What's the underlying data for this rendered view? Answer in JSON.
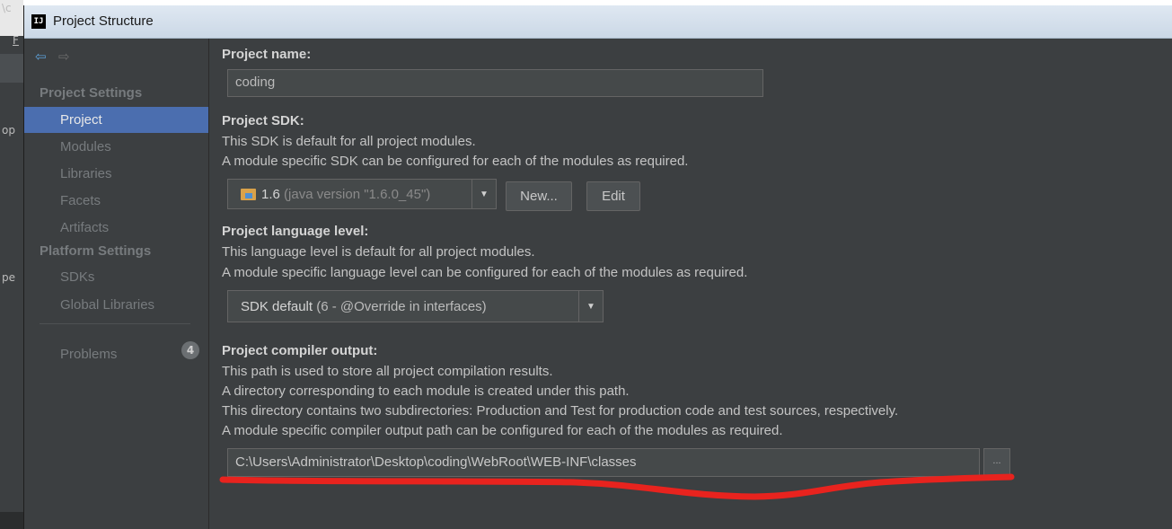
{
  "background_fragments": [
    "\\c",
    "F",
    "op",
    "pe"
  ],
  "window": {
    "title": "Project Structure",
    "logo_text": "IJ"
  },
  "sidebar": {
    "project_settings_header": "Project Settings",
    "project_settings_items": [
      {
        "label": "Project",
        "selected": true
      },
      {
        "label": "Modules"
      },
      {
        "label": "Libraries"
      },
      {
        "label": "Facets"
      },
      {
        "label": "Artifacts"
      }
    ],
    "platform_settings_header": "Platform Settings",
    "platform_settings_items": [
      {
        "label": "SDKs"
      },
      {
        "label": "Global Libraries"
      }
    ],
    "problems": {
      "label": "Problems",
      "count": "4"
    }
  },
  "main": {
    "project_name": {
      "label": "Project name:",
      "value": "coding"
    },
    "project_sdk": {
      "label": "Project SDK:",
      "desc1": "This SDK is default for all project modules.",
      "desc2": "A module specific SDK can be configured for each of the modules as required.",
      "selected_version": "1.6",
      "selected_detail": " (java version \"1.6.0_45\")",
      "new_button": "New...",
      "edit_button": "Edit"
    },
    "language_level": {
      "label": "Project language level:",
      "desc1": "This language level is default for all project modules.",
      "desc2": "A module specific language level can be configured for each of the modules as required.",
      "selected_main": "SDK default",
      "selected_detail": " (6 - @Override in interfaces)"
    },
    "compiler_output": {
      "label": "Project compiler output:",
      "desc1": "This path is used to store all project compilation results.",
      "desc2": "A directory corresponding to each module is created under this path.",
      "desc3": "This directory contains two subdirectories: Production and Test for production code and test sources, respectively.",
      "desc4": "A module specific compiler output path can be configured for each of the modules as required.",
      "path": "C:\\Users\\Administrator\\Desktop\\coding\\WebRoot\\WEB-INF\\classes",
      "browse_label": "..."
    }
  },
  "colors": {
    "selection": "#4b6eaf",
    "annotation": "#e8231e",
    "panel": "#3c3f41"
  }
}
